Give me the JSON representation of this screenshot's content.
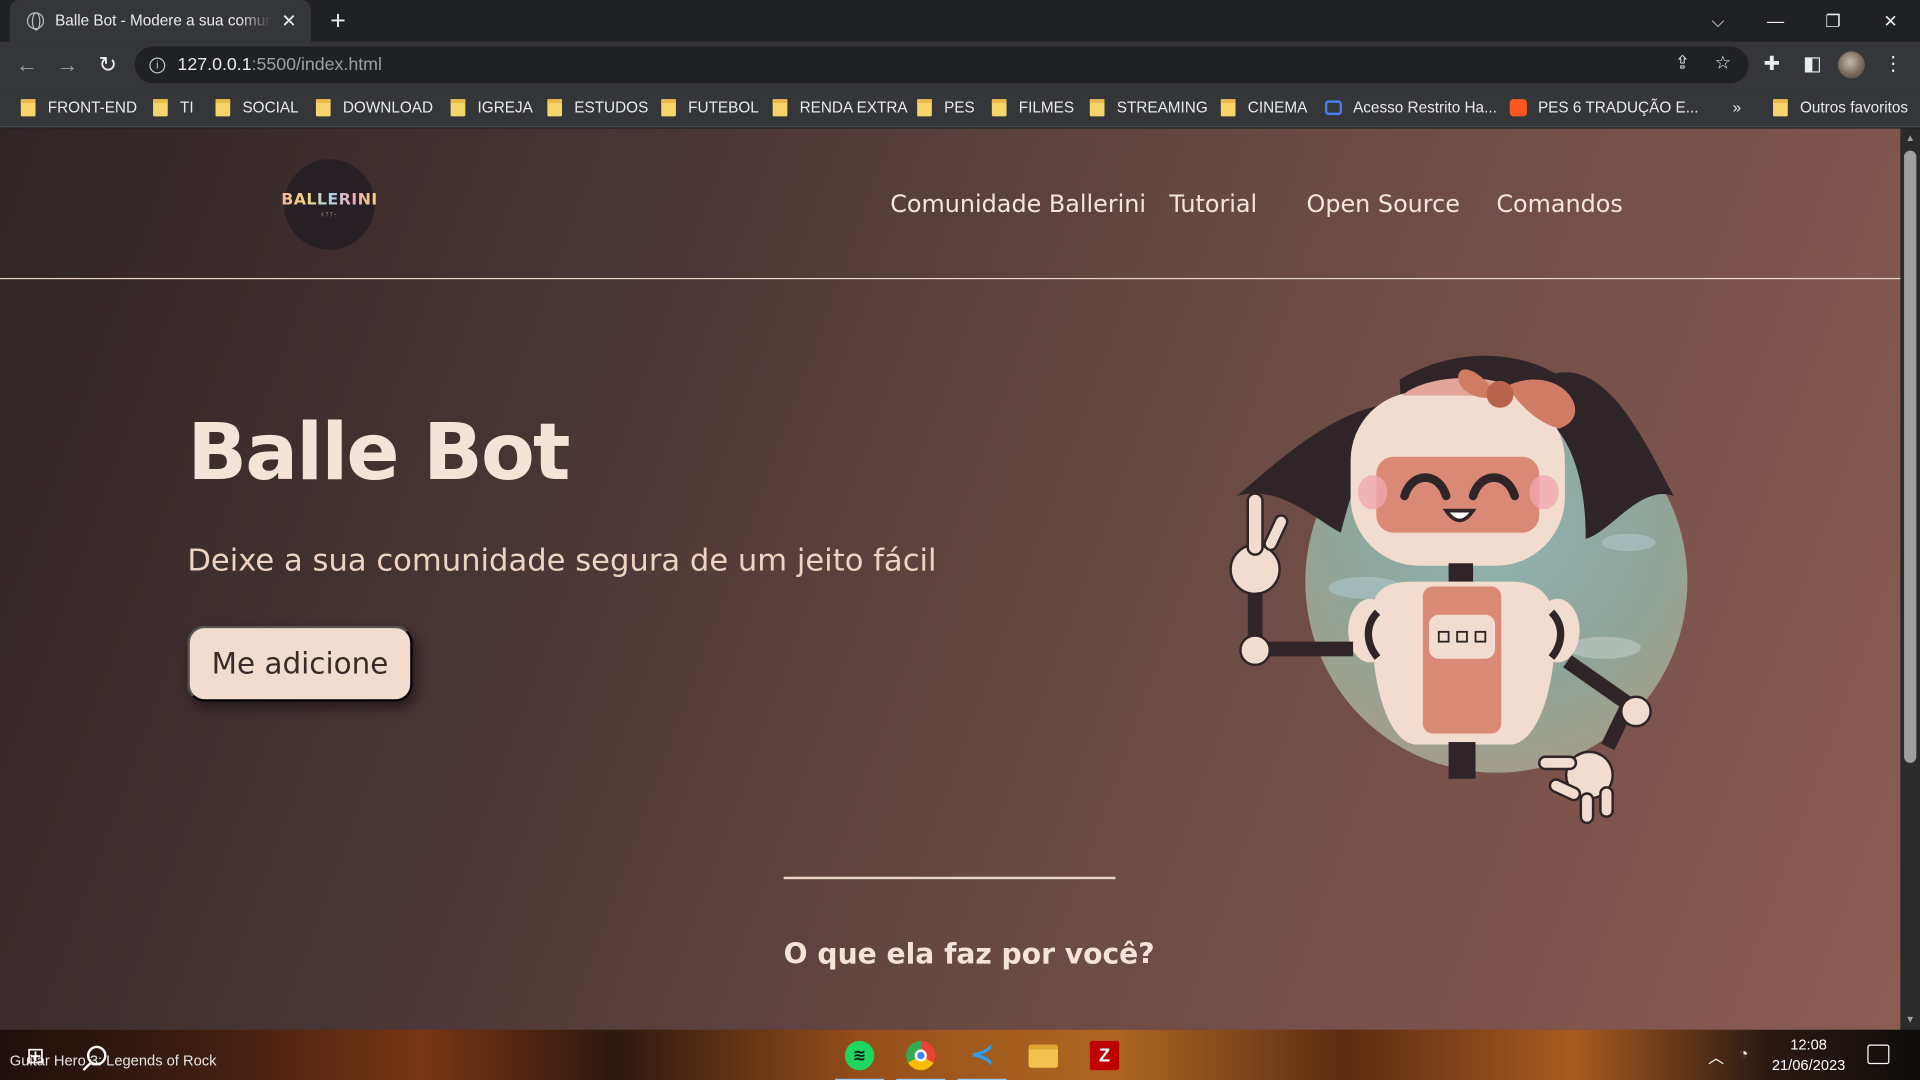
{
  "browser": {
    "tab": {
      "title": "Balle Bot - Modere a sua comunidade",
      "close": "✕"
    },
    "new_tab": "+",
    "window_controls": {
      "dropdown": "⌵",
      "minimize": "—",
      "restore": "❐",
      "close": "✕"
    },
    "url": {
      "host": "127.0.0.1",
      "path": ":5500/index.html"
    },
    "bookmarks": [
      {
        "label": "FRONT-END",
        "icon": "folder-icon"
      },
      {
        "label": "TI",
        "icon": "folder-icon"
      },
      {
        "label": "SOCIAL",
        "icon": "folder-icon"
      },
      {
        "label": "DOWNLOAD",
        "icon": "folder-icon"
      },
      {
        "label": "IGREJA",
        "icon": "folder-icon"
      },
      {
        "label": "ESTUDOS",
        "icon": "folder-icon"
      },
      {
        "label": "FUTEBOL",
        "icon": "folder-icon"
      },
      {
        "label": "RENDA EXTRA",
        "icon": "folder-icon"
      },
      {
        "label": "PES",
        "icon": "folder-icon"
      },
      {
        "label": "FILMES",
        "icon": "folder-icon"
      },
      {
        "label": "STREAMING",
        "icon": "folder-icon"
      },
      {
        "label": "CINEMA",
        "icon": "folder-icon"
      },
      {
        "label": "Acesso Restrito Ha...",
        "icon": "site-favicon"
      },
      {
        "label": "PES 6 TRADUÇÃO E...",
        "icon": "blogger-icon"
      }
    ],
    "bookmarks_overflow": "»",
    "other_bookmarks": "Outros favoritos"
  },
  "site": {
    "logo": {
      "text": "BALLERINI",
      "sub": "ﾒﾌﾌｰ"
    },
    "nav": [
      {
        "label": "Comunidade Ballerini"
      },
      {
        "label": "Tutorial"
      },
      {
        "label": "Open Source"
      },
      {
        "label": "Comandos"
      }
    ],
    "hero": {
      "title": "Balle Bot",
      "subtitle": "Deixe a sua comunidade segura de um jeito fácil",
      "cta": "Me adicione"
    },
    "section_title": "O que ela faz por você?",
    "colors": {
      "accent": "#f1dccf",
      "text": "#f4e3d6",
      "bg_dark": "#2f2425",
      "bg_light": "#8b5c53"
    }
  },
  "taskbar": {
    "now_playing": "Guitar Hero 3: Legends of Rock",
    "apps": [
      "spotify-icon",
      "chrome-icon",
      "vscode-icon",
      "file-explorer-icon",
      "filezilla-icon"
    ],
    "clock": {
      "time": "12:08",
      "date": "21/06/2023"
    }
  }
}
